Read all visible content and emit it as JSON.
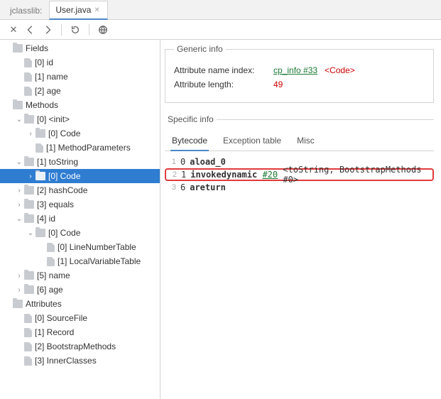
{
  "tabs": {
    "items": [
      {
        "label": "jclasslib:",
        "active": false
      },
      {
        "label": "User.java",
        "active": true
      }
    ]
  },
  "tree": [
    {
      "depth": 0,
      "arrow": "",
      "icon": "folder",
      "label": "Fields"
    },
    {
      "depth": 1,
      "arrow": "",
      "icon": "file",
      "label": "[0] id"
    },
    {
      "depth": 1,
      "arrow": "",
      "icon": "file",
      "label": "[1] name"
    },
    {
      "depth": 1,
      "arrow": "",
      "icon": "file",
      "label": "[2] age"
    },
    {
      "depth": 0,
      "arrow": "",
      "icon": "folder",
      "label": "Methods",
      "stripe": true
    },
    {
      "depth": 1,
      "arrow": "v",
      "icon": "folder",
      "label": "[0] <init>"
    },
    {
      "depth": 2,
      "arrow": ">",
      "icon": "folder",
      "label": "[0] Code"
    },
    {
      "depth": 2,
      "arrow": "",
      "icon": "file",
      "label": "[1] MethodParameters"
    },
    {
      "depth": 1,
      "arrow": "v",
      "icon": "folder",
      "label": "[1] toString"
    },
    {
      "depth": 2,
      "arrow": ">",
      "icon": "folder",
      "label": "[0] Code",
      "selected": true
    },
    {
      "depth": 1,
      "arrow": ">",
      "icon": "folder",
      "label": "[2] hashCode",
      "stripe": true
    },
    {
      "depth": 1,
      "arrow": ">",
      "icon": "folder",
      "label": "[3] equals"
    },
    {
      "depth": 1,
      "arrow": "v",
      "icon": "folder",
      "label": "[4] id"
    },
    {
      "depth": 2,
      "arrow": "v",
      "icon": "folder",
      "label": "[0] Code"
    },
    {
      "depth": 3,
      "arrow": "",
      "icon": "file",
      "label": "[0] LineNumberTable"
    },
    {
      "depth": 3,
      "arrow": "",
      "icon": "file",
      "label": "[1] LocalVariableTable"
    },
    {
      "depth": 1,
      "arrow": ">",
      "icon": "folder",
      "label": "[5] name"
    },
    {
      "depth": 1,
      "arrow": ">",
      "icon": "folder",
      "label": "[6] age"
    },
    {
      "depth": 0,
      "arrow": "",
      "icon": "folder",
      "label": "Attributes"
    },
    {
      "depth": 1,
      "arrow": "",
      "icon": "file",
      "label": "[0] SourceFile"
    },
    {
      "depth": 1,
      "arrow": "",
      "icon": "file",
      "label": "[1] Record"
    },
    {
      "depth": 1,
      "arrow": "",
      "icon": "file",
      "label": "[2] BootstrapMethods"
    },
    {
      "depth": 1,
      "arrow": "",
      "icon": "file",
      "label": "[3] InnerClasses"
    }
  ],
  "generic": {
    "legend": "Generic info",
    "rows": {
      "name_index_k": "Attribute name index:",
      "name_index_link": "cp_info #33",
      "name_index_tag": "<Code>",
      "length_k": "Attribute length:",
      "length_v": "49"
    }
  },
  "specific": {
    "legend": "Specific info",
    "tabs": [
      {
        "label": "Bytecode",
        "active": true
      },
      {
        "label": "Exception table",
        "active": false
      },
      {
        "label": "Misc",
        "active": false
      }
    ],
    "bytecode": [
      {
        "ln": "1",
        "offset": "0",
        "op": "aload_0",
        "arg": "",
        "cmt": ""
      },
      {
        "ln": "2",
        "offset": "1",
        "op": "invokedynamic",
        "arg": "#20",
        "cmt": "<toString, BootstrapMethods #0>",
        "hl": true
      },
      {
        "ln": "3",
        "offset": "6",
        "op": "areturn",
        "arg": "",
        "cmt": ""
      }
    ]
  }
}
